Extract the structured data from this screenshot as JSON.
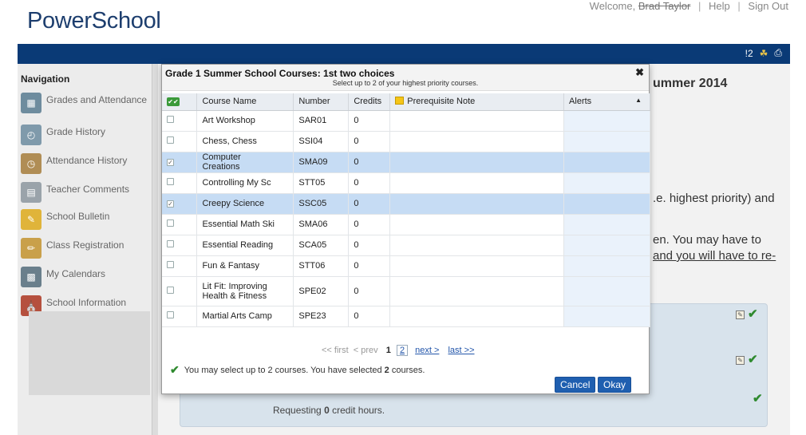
{
  "header": {
    "logo": "PowerSchool",
    "welcome_prefix": "Welcome,",
    "user": "Brad Taylor",
    "help": "Help",
    "signout": "Sign Out",
    "alert_count": "!2"
  },
  "sidebar": {
    "title": "Navigation",
    "items": [
      {
        "label": "Grades and Attendance",
        "icon": "grades-icon"
      },
      {
        "label": "Grade History",
        "icon": "grade-history-icon"
      },
      {
        "label": "Attendance History",
        "icon": "attendance-history-icon"
      },
      {
        "label": "Teacher Comments",
        "icon": "comments-icon"
      },
      {
        "label": "School Bulletin",
        "icon": "bulletin-icon"
      },
      {
        "label": "Class Registration",
        "icon": "registration-icon"
      },
      {
        "label": "My Calendars",
        "icon": "calendar-icon"
      },
      {
        "label": "School Information",
        "icon": "school-icon"
      }
    ]
  },
  "main": {
    "title_fragment": "ummer 2014",
    "line1": ".e. highest priority) and",
    "line2": "en. You may have to",
    "line3": "and you will have to re-",
    "requesting_prefix": "Requesting",
    "requesting_value": "0",
    "requesting_suffix": "credit hours."
  },
  "dialog": {
    "title": "Grade 1 Summer School Courses: 1st two choices",
    "subtitle": "Select up to 2 of your highest priority courses.",
    "columns": {
      "course": "Course Name",
      "number": "Number",
      "credits": "Credits",
      "note": "Prerequisite Note",
      "alerts": "Alerts"
    },
    "rows": [
      {
        "name": "Art Workshop",
        "number": "SAR01",
        "credits": "0",
        "selected": false
      },
      {
        "name": "Chess, Chess",
        "number": "SSI04",
        "credits": "0",
        "selected": false
      },
      {
        "name": "Computer Creations",
        "number": "SMA09",
        "credits": "0",
        "selected": true
      },
      {
        "name": "Controlling My Sc",
        "number": "STT05",
        "credits": "0",
        "selected": false
      },
      {
        "name": "Creepy Science",
        "number": "SSC05",
        "credits": "0",
        "selected": true
      },
      {
        "name": "Essential Math Ski",
        "number": "SMA06",
        "credits": "0",
        "selected": false
      },
      {
        "name": "Essential Reading",
        "number": "SCA05",
        "credits": "0",
        "selected": false
      },
      {
        "name": "Fun & Fantasy",
        "number": "STT06",
        "credits": "0",
        "selected": false
      },
      {
        "name": "Lit Fit: Improving Health & Fitness",
        "number": "SPE02",
        "credits": "0",
        "selected": false
      },
      {
        "name": "Martial Arts Camp",
        "number": "SPE23",
        "credits": "0",
        "selected": false
      }
    ],
    "pager": {
      "first": "<< first",
      "prev": "< prev",
      "page1": "1",
      "page2": "2",
      "next": "next >",
      "last": "last >>"
    },
    "status_prefix": "You may select up to 2 courses. You have selected",
    "status_count": "2",
    "status_suffix": "courses.",
    "cancel": "Cancel",
    "okay": "Okay"
  },
  "colors": {
    "topbar": "#0a3a76",
    "selected_row": "#c6dcf4",
    "button": "#1f5fb0",
    "check": "#2f8a2f"
  }
}
